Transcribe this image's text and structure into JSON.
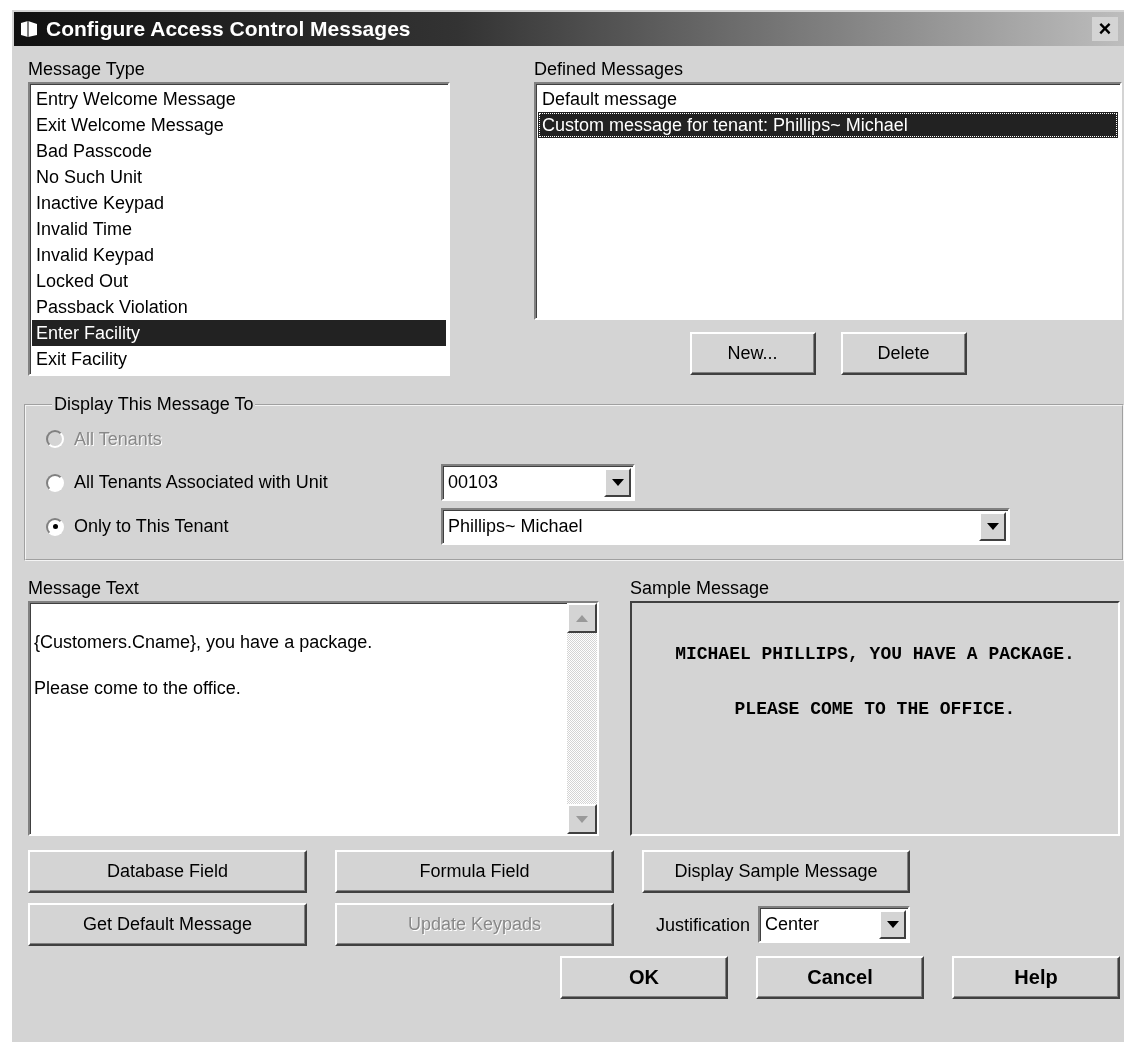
{
  "window": {
    "title": "Configure Access Control Messages",
    "close": "×"
  },
  "message_type": {
    "label": "Message Type",
    "items": [
      {
        "text": "Entry Welcome Message",
        "selected": false
      },
      {
        "text": "Exit Welcome Message",
        "selected": false
      },
      {
        "text": "Bad Passcode",
        "selected": false
      },
      {
        "text": "No Such Unit",
        "selected": false
      },
      {
        "text": "Inactive Keypad",
        "selected": false
      },
      {
        "text": "Invalid Time",
        "selected": false
      },
      {
        "text": "Invalid Keypad",
        "selected": false
      },
      {
        "text": "Locked Out",
        "selected": false
      },
      {
        "text": "Passback Violation",
        "selected": false
      },
      {
        "text": "Enter Facility",
        "selected": true
      },
      {
        "text": "Exit Facility",
        "selected": false
      }
    ]
  },
  "defined_messages": {
    "label": "Defined Messages",
    "items": [
      {
        "text": "Default message",
        "selected": false
      },
      {
        "text": "Custom message for tenant: Phillips~ Michael",
        "selected": true
      }
    ],
    "buttons": [
      {
        "label": "New...",
        "disabled": false
      },
      {
        "label": "Delete",
        "disabled": false
      }
    ]
  },
  "display_to": {
    "title": "Display This Message To",
    "options": [
      {
        "label": "All Tenants",
        "selected": false,
        "disabled": true
      },
      {
        "label": "All Tenants Associated with Unit",
        "selected": false,
        "disabled": false,
        "combo": "00103"
      },
      {
        "label": "Only to This Tenant",
        "selected": true,
        "disabled": false,
        "combo": "Phillips~ Michael"
      }
    ]
  },
  "message_text": {
    "label": "Message Text",
    "lines": [
      "{Customers.Cname}, you have a package.",
      "Please come to the office."
    ]
  },
  "sample_message": {
    "label": "Sample Message",
    "lines": [
      "MICHAEL PHILLIPS, YOU HAVE A PACKAGE.",
      "PLEASE COME TO THE OFFICE."
    ]
  },
  "field_buttons": [
    {
      "label": "Database Field",
      "disabled": false
    },
    {
      "label": "Formula Field",
      "disabled": false
    },
    {
      "label": "Get Default Message",
      "disabled": false
    },
    {
      "label": "Update Keypads",
      "disabled": true
    }
  ],
  "sample_button": {
    "label": "Display Sample Message",
    "disabled": false
  },
  "justification": {
    "label": "Justification",
    "value": "Center"
  },
  "dialog_buttons": [
    {
      "label": "OK",
      "disabled": false
    },
    {
      "label": "Cancel",
      "disabled": false
    },
    {
      "label": "Help",
      "disabled": false
    }
  ]
}
